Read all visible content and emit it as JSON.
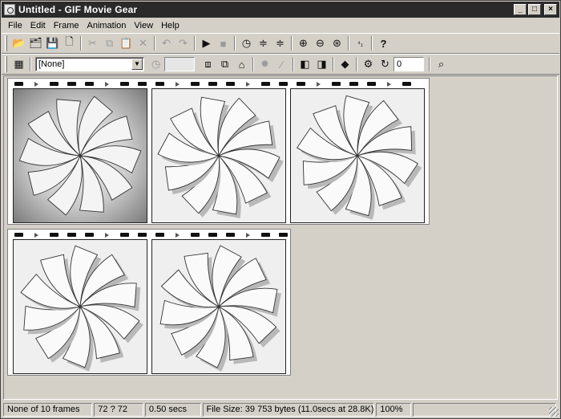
{
  "window": {
    "title": "Untitled - GIF Movie Gear"
  },
  "titlebar_buttons": {
    "minimize": "_",
    "maximize": "□",
    "close": "×"
  },
  "menu": [
    "File",
    "Edit",
    "Frame",
    "Animation",
    "View",
    "Help"
  ],
  "toolbar1": {
    "icons": [
      "open-icon",
      "import-icon",
      "save-icon",
      "new-icon",
      "cut-icon",
      "copy-icon",
      "paste-icon",
      "delete-icon",
      "undo-icon",
      "redo-icon",
      "play-icon",
      "stop-icon",
      "timing-icon",
      "scale-icon",
      "crop-icon",
      "zoom-in-icon",
      "zoom-out-icon",
      "zoom-fit-icon",
      "frame-number-icon",
      "help-icon"
    ],
    "glyphs": [
      "📂",
      "🗂",
      "💾",
      "🗋",
      "✂",
      "⧉",
      "📋",
      "✕",
      "↶",
      "↷",
      "▶",
      "■",
      "◷",
      "≑",
      "≑",
      "⊕",
      "⊖",
      "⊛",
      "⁴₁",
      "?"
    ]
  },
  "toolbar2": {
    "palette_select": "[None]",
    "delay_value": "",
    "loop_value": "0"
  },
  "status": {
    "frames": "None of 10 frames",
    "size": "72 ? 72",
    "delay": "0.50 secs",
    "filesize": "File Size: 39 753 bytes  (11.0secs at 28.8K)",
    "zoom": "100%"
  },
  "colors": {
    "titlebar": "#2a2a2a",
    "chrome": "#d4d0c8",
    "workspace": "#d4d0c8"
  },
  "frames_count_visible": 5
}
